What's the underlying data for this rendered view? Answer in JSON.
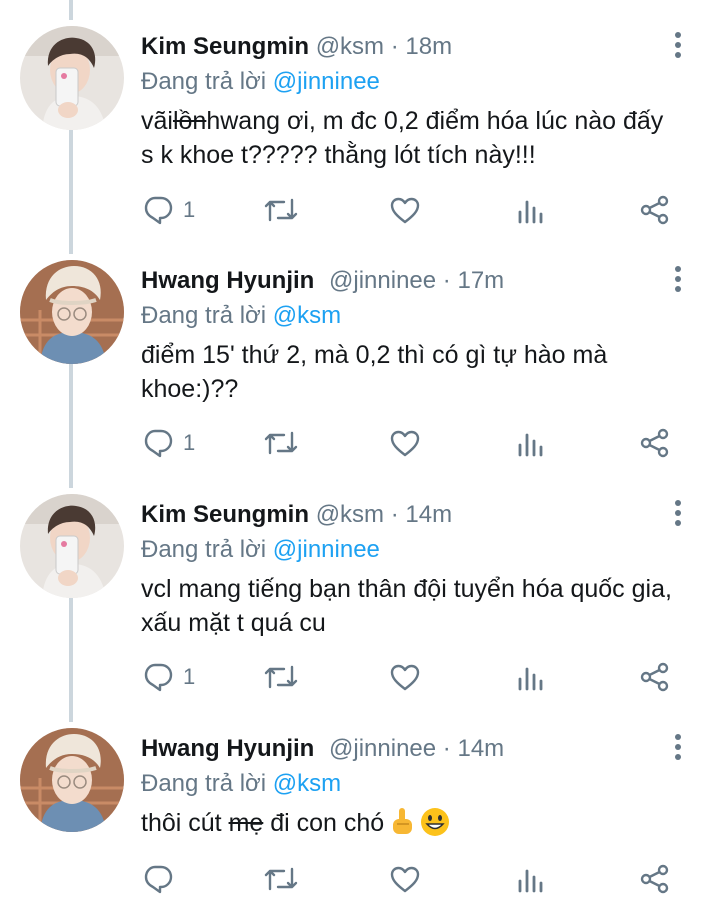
{
  "colors": {
    "accent": "#1da1f2",
    "text": "#14171a",
    "secondary": "#657786",
    "thread_line": "#ccd6dd"
  },
  "tweets": [
    {
      "name": "Kim Seungmin",
      "handle": "@ksm",
      "separator": "·",
      "time": "18m",
      "replying_prefix": "Đang trả lời",
      "replying_to": "@jinninee",
      "body_parts": [
        "vãi",
        "lồn",
        "hwang ơi, m đc 0,2 điểm hóa lúc nào đấy s k khoe t????? thằng lót tích này!!!"
      ],
      "reply_count": "1",
      "avatar": "kim-seungmin"
    },
    {
      "name": "Hwang Hyunjin",
      "handle": "@jinninee",
      "separator": "·",
      "time": "17m",
      "replying_prefix": "Đang trả lời",
      "replying_to": "@ksm",
      "body_parts": [
        "điểm 15' thứ 2, mà 0,2 thì có gì tự hào mà khoe:)??"
      ],
      "reply_count": "1",
      "avatar": "hwang-hyunjin"
    },
    {
      "name": "Kim Seungmin",
      "handle": "@ksm",
      "separator": "·",
      "time": "14m",
      "replying_prefix": "Đang trả lời",
      "replying_to": "@jinninee",
      "body_parts": [
        "vcl mang tiếng bạn thân đội tuyển hóa quốc gia, xấu mặt t quá cu"
      ],
      "reply_count": "1",
      "avatar": "kim-seungmin"
    },
    {
      "name": "Hwang Hyunjin",
      "handle": "@jinninee",
      "separator": "·",
      "time": "14m",
      "replying_prefix": "Đang trả lời",
      "replying_to": "@ksm",
      "body_parts": [
        "thôi cút ",
        "mẹ",
        " đi con chó"
      ],
      "emoji": [
        "middle-finger-emoji",
        "grinning-face-emoji"
      ],
      "reply_count": "",
      "avatar": "hwang-hyunjin"
    }
  ],
  "icons": [
    "reply-icon",
    "retweet-icon",
    "like-icon",
    "analytics-icon",
    "share-icon",
    "more-icon"
  ]
}
